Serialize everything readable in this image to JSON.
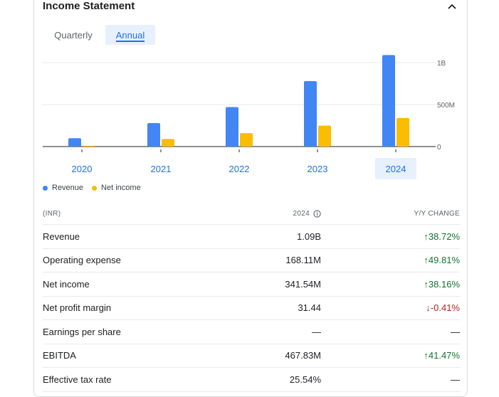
{
  "header": {
    "title": "Income Statement"
  },
  "tabs": [
    {
      "label": "Quarterly"
    },
    {
      "label": "Annual"
    }
  ],
  "chart_data": {
    "type": "bar",
    "categories": [
      "2020",
      "2021",
      "2022",
      "2023",
      "2024"
    ],
    "selected_category": "2024",
    "series": [
      {
        "name": "Revenue",
        "color": "#4285f4",
        "values": [
          0.1,
          0.28,
          0.47,
          0.78,
          1.09
        ]
      },
      {
        "name": "Net income",
        "color": "#fbbc04",
        "values": [
          0.01,
          0.09,
          0.16,
          0.25,
          0.34
        ]
      }
    ],
    "ytick_labels": [
      "0",
      "500M",
      "1B"
    ],
    "yticks": [
      0,
      0.5,
      1.0
    ],
    "ylim": [
      0,
      1.1
    ],
    "units": "billions",
    "legend": "bottom-left",
    "grid": true
  },
  "legend": {
    "revenue": "Revenue",
    "net_income": "Net income"
  },
  "table": {
    "headers": {
      "label": "(INR)",
      "year": "2024",
      "change": "Y/Y CHANGE"
    },
    "rows": [
      {
        "label": "Revenue",
        "value": "1.09B",
        "change": "↑38.72%",
        "dir": "up"
      },
      {
        "label": "Operating expense",
        "value": "168.11M",
        "change": "↑49.81%",
        "dir": "up"
      },
      {
        "label": "Net income",
        "value": "341.54M",
        "change": "↑38.16%",
        "dir": "up"
      },
      {
        "label": "Net profit margin",
        "value": "31.44",
        "change": "↓-0.41%",
        "dir": "down"
      },
      {
        "label": "Earnings per share",
        "value": "—",
        "change": "—",
        "dir": "none"
      },
      {
        "label": "EBITDA",
        "value": "467.83M",
        "change": "↑41.47%",
        "dir": "up"
      },
      {
        "label": "Effective tax rate",
        "value": "25.54%",
        "change": "—",
        "dir": "none"
      }
    ]
  }
}
